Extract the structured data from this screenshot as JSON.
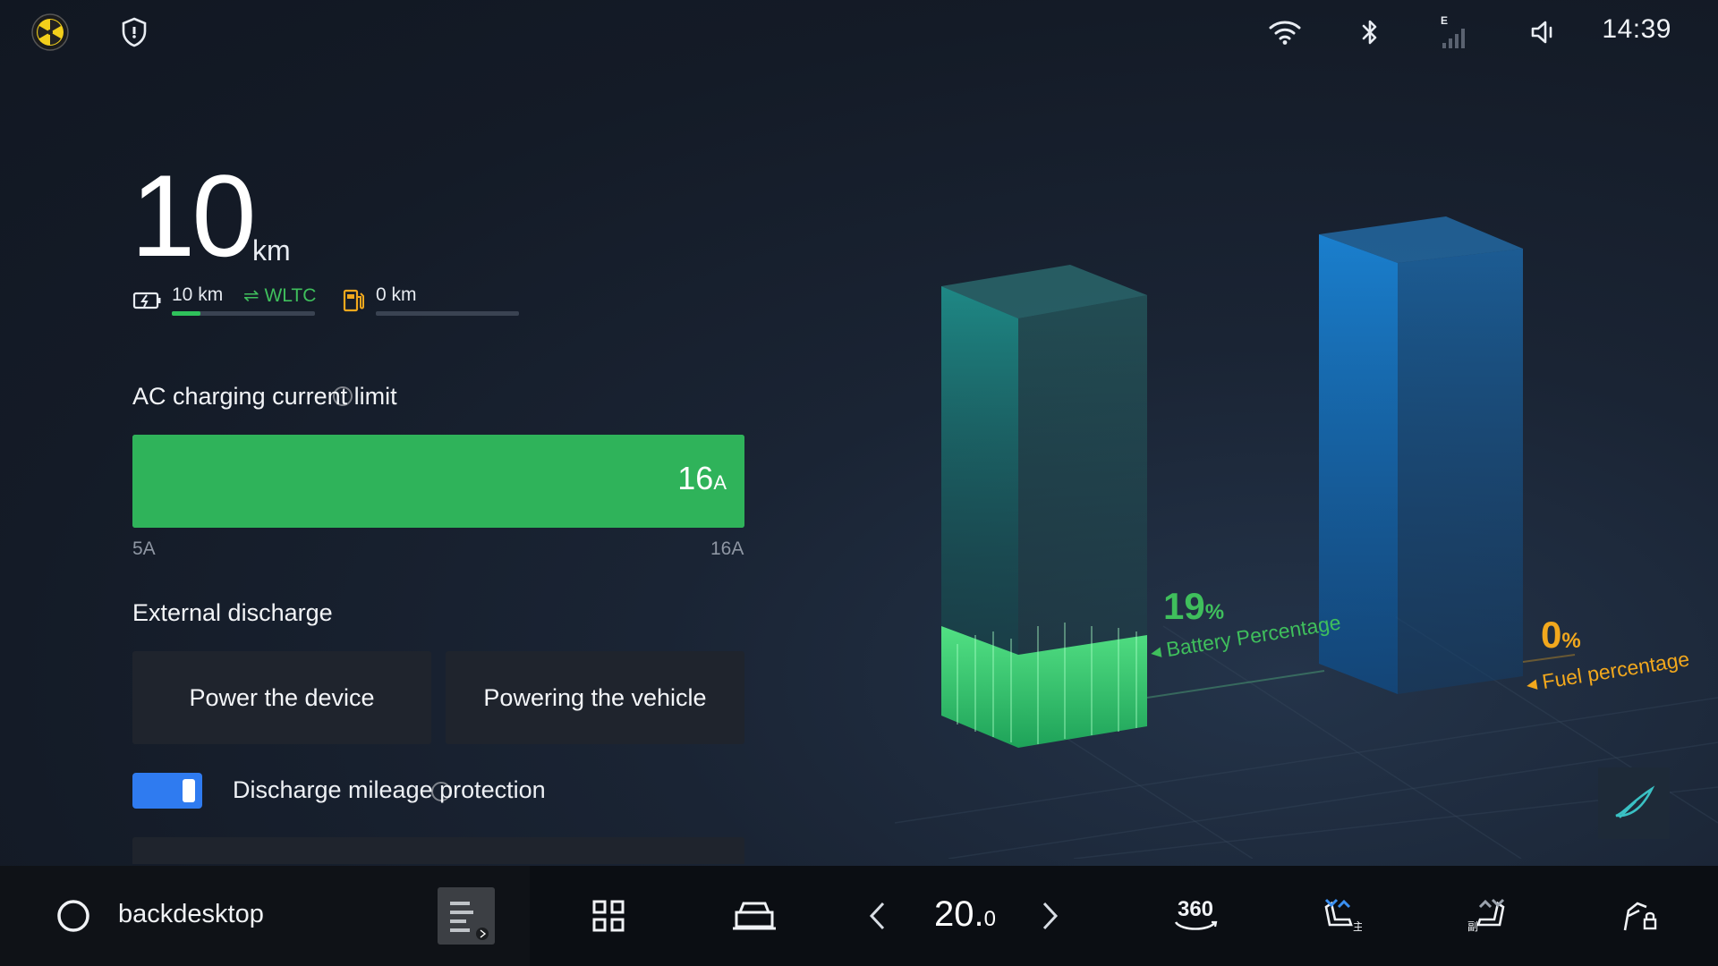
{
  "status_bar": {
    "time": "14:39",
    "signal_label": "E",
    "icons": [
      "app-logo-icon",
      "shield-icon",
      "wifi-icon",
      "bluetooth-icon",
      "cellular-signal-icon",
      "volume-icon"
    ]
  },
  "range": {
    "value": "10",
    "unit": "km",
    "electric_range": "10 km",
    "standard": "WLTC",
    "fuel_range": "0 km",
    "electric_fill": 0.2,
    "fuel_fill": 0
  },
  "charging": {
    "title": "AC charging current limit",
    "value": "16",
    "value_unit": "A",
    "min_label": "5A",
    "max_label": "16A",
    "level": 1.0
  },
  "discharge": {
    "title": "External discharge",
    "btn_power_device": "Power the device",
    "btn_powering_vehicle": "Powering the vehicle",
    "protection_label": "Discharge mileage protection",
    "protection_on": true
  },
  "energy_bars": {
    "battery_value": "19",
    "battery_unit": "%",
    "battery_label": "Battery Percentage",
    "fuel_value": "0",
    "fuel_unit": "%",
    "fuel_label": "Fuel percentage"
  },
  "dock": {
    "home_label": "backdesktop",
    "temperature": "20.",
    "temperature_decimal": "0",
    "camera_label": "360"
  },
  "colors": {
    "accent_green": "#2fb35a",
    "accent_blue": "#2f7bf0",
    "fuel_orange": "#f2a81d",
    "battery_green": "#3fbf5c"
  }
}
